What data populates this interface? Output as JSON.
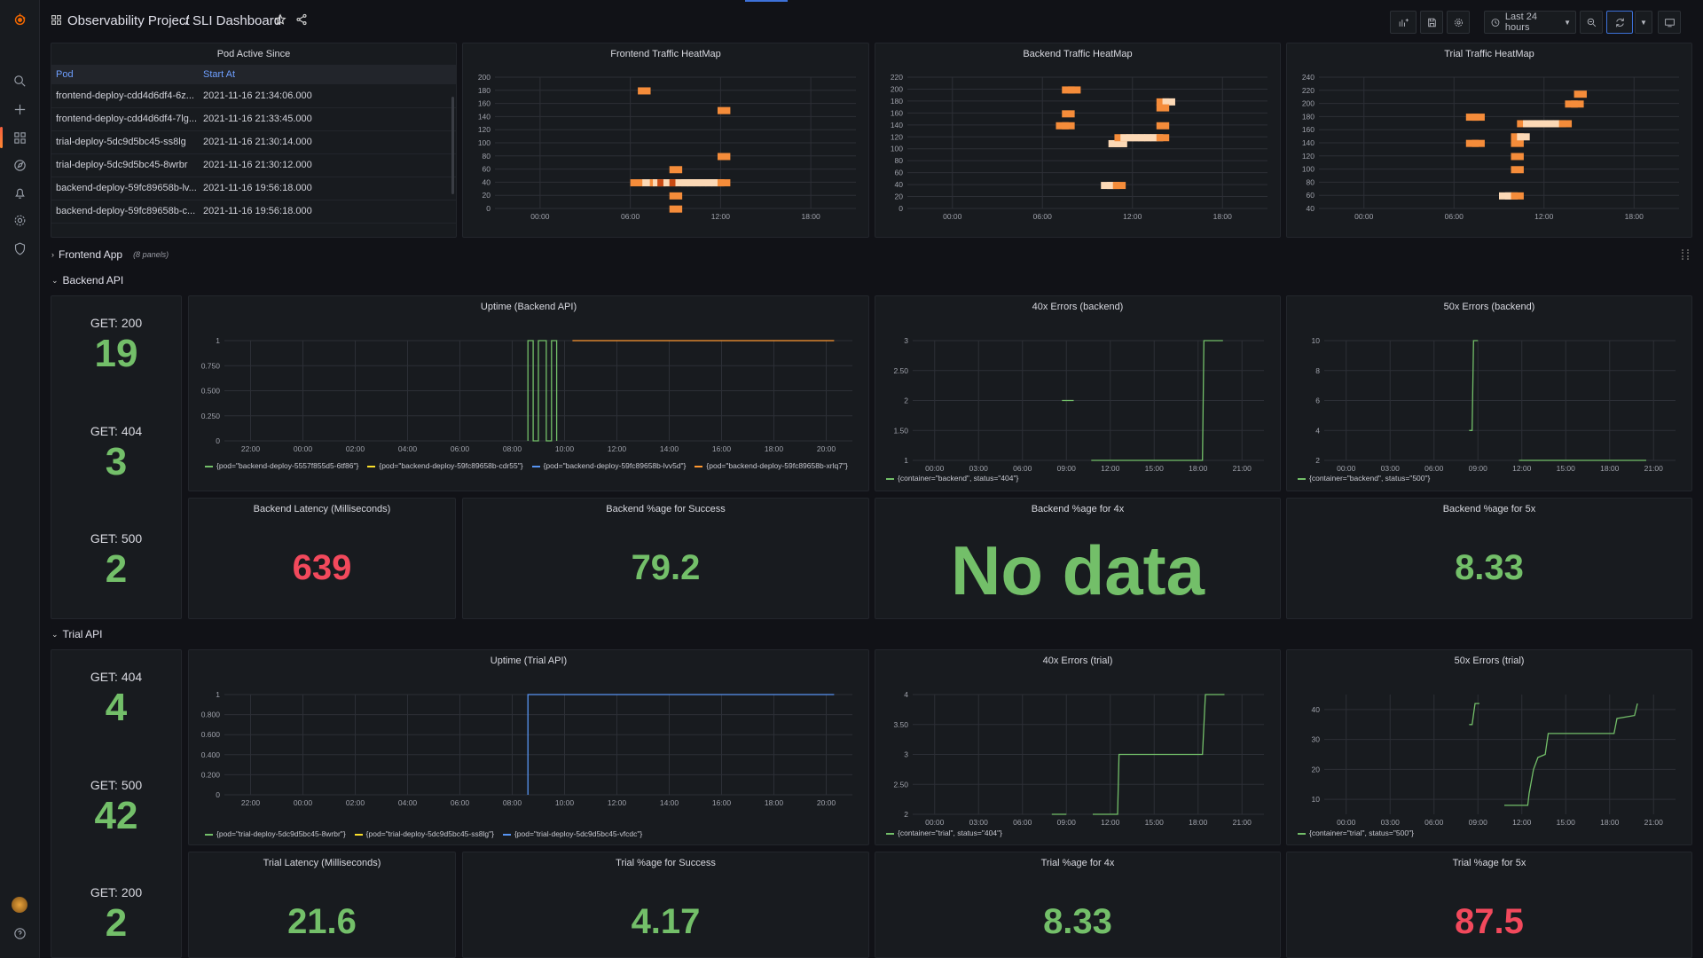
{
  "app": {
    "breadcrumb_folder": "Observability Project",
    "breadcrumb_sep": "/",
    "breadcrumb_dashboard": "SLI Dashboard",
    "time_range": "Last 24 hours"
  },
  "colors": {
    "green": "#73bf69",
    "red": "#f2495c",
    "blue": "#5794f2",
    "orange": "#ff9830",
    "yellow": "#fade2a",
    "accent": "#6e9fff"
  },
  "rail_icons": [
    "grafana-logo-icon",
    "search-icon",
    "plus-icon",
    "dashboards-icon",
    "explore-icon",
    "alerting-icon",
    "gear-icon",
    "shield-icon",
    "avatar",
    "help-icon"
  ],
  "pods_table": {
    "title": "Pod Active Since",
    "columns": [
      "Pod",
      "Start At"
    ],
    "rows": [
      [
        "frontend-deploy-cdd4d6df4-6z...",
        "2021-11-16 21:34:06.000"
      ],
      [
        "frontend-deploy-cdd4d6df4-7lg...",
        "2021-11-16 21:33:45.000"
      ],
      [
        "trial-deploy-5dc9d5bc45-ss8lg",
        "2021-11-16 21:30:14.000"
      ],
      [
        "trial-deploy-5dc9d5bc45-8wrbr",
        "2021-11-16 21:30:12.000"
      ],
      [
        "backend-deploy-59fc89658b-lv...",
        "2021-11-16 19:56:18.000"
      ],
      [
        "backend-deploy-59fc89658b-c...",
        "2021-11-16 19:56:18.000"
      ]
    ]
  },
  "rows": {
    "frontend": {
      "label": "Frontend App",
      "sub": "(8 panels)"
    },
    "backend": {
      "label": "Backend API"
    },
    "trial": {
      "label": "Trial API"
    }
  },
  "backend_codes": [
    {
      "label": "GET: 200",
      "value": "19"
    },
    {
      "label": "GET: 404",
      "value": "3"
    },
    {
      "label": "GET: 500",
      "value": "2"
    }
  ],
  "trial_codes": [
    {
      "label": "GET: 404",
      "value": "4"
    },
    {
      "label": "GET: 500",
      "value": "42"
    },
    {
      "label": "GET: 200",
      "value": "2"
    }
  ],
  "backend_stats": [
    {
      "title": "Backend Latency (Milliseconds)",
      "value": "639",
      "color": "#f2495c"
    },
    {
      "title": "Backend %age for Success",
      "value": "79.2",
      "color": "#73bf69"
    },
    {
      "title": "Backend %age for 4x",
      "value": "No data",
      "color": "#73bf69"
    },
    {
      "title": "Backend %age for 5x",
      "value": "8.33",
      "color": "#73bf69"
    }
  ],
  "trial_stats": [
    {
      "title": "Trial Latency (Milliseconds)",
      "value": "21.6",
      "color": "#73bf69"
    },
    {
      "title": "Trial %age for Success",
      "value": "4.17",
      "color": "#73bf69"
    },
    {
      "title": "Trial %age for 4x",
      "value": "8.33",
      "color": "#73bf69"
    },
    {
      "title": "Trial %age for 5x",
      "value": "87.5",
      "color": "#f2495c"
    }
  ],
  "chart_data": [
    {
      "id": "frontend_heatmap",
      "type": "heatmap",
      "title": "Frontend Traffic HeatMap",
      "x_ticks": [
        "00:00",
        "06:00",
        "12:00",
        "18:00"
      ],
      "y_ticks": [
        "0",
        "20",
        "40",
        "60",
        "80",
        "100",
        "120",
        "140",
        "160",
        "180",
        "200"
      ],
      "ylim": [
        0,
        200
      ],
      "cells": [
        [
          9.5,
          180,
          1
        ],
        [
          9.0,
          40,
          1
        ],
        [
          9.8,
          40,
          0
        ],
        [
          10.3,
          40,
          1
        ],
        [
          10.5,
          40,
          0
        ],
        [
          10.8,
          40,
          2
        ],
        [
          11.2,
          40,
          0
        ],
        [
          11.6,
          40,
          2
        ],
        [
          11.6,
          60,
          1
        ],
        [
          11.6,
          20,
          1
        ],
        [
          11.6,
          0,
          1
        ],
        [
          12.0,
          40,
          0
        ],
        [
          12.4,
          40,
          0
        ],
        [
          12.8,
          40,
          0
        ],
        [
          13.2,
          40,
          0
        ],
        [
          13.6,
          40,
          0
        ],
        [
          14.0,
          40,
          0
        ],
        [
          14.4,
          40,
          0
        ],
        [
          14.8,
          40,
          1
        ],
        [
          14.8,
          80,
          1
        ],
        [
          14.8,
          150,
          1
        ]
      ]
    },
    {
      "id": "backend_heatmap",
      "type": "heatmap",
      "title": "Backend Traffic HeatMap",
      "x_ticks": [
        "00:00",
        "06:00",
        "12:00",
        "18:00"
      ],
      "y_ticks": [
        "0",
        "20",
        "40",
        "60",
        "80",
        "100",
        "120",
        "140",
        "160",
        "180",
        "200",
        "220"
      ],
      "ylim": [
        0,
        220
      ],
      "cells": [
        [
          10.3,
          200,
          1
        ],
        [
          10.7,
          200,
          1
        ],
        [
          9.9,
          140,
          1
        ],
        [
          10.3,
          140,
          1
        ],
        [
          10.3,
          160,
          1
        ],
        [
          12.9,
          40,
          0
        ],
        [
          13.3,
          40,
          0
        ],
        [
          13.7,
          40,
          1
        ],
        [
          13.4,
          110,
          0
        ],
        [
          13.8,
          110,
          0
        ],
        [
          13.8,
          120,
          1
        ],
        [
          14.2,
          120,
          0
        ],
        [
          14.6,
          120,
          0
        ],
        [
          15.0,
          120,
          0
        ],
        [
          15.4,
          120,
          0
        ],
        [
          15.8,
          120,
          0
        ],
        [
          16.2,
          120,
          0
        ],
        [
          16.6,
          120,
          1
        ],
        [
          16.6,
          140,
          1
        ],
        [
          16.6,
          180,
          1
        ],
        [
          17.0,
          180,
          0
        ],
        [
          16.6,
          170,
          1
        ]
      ]
    },
    {
      "id": "trial_heatmap",
      "type": "heatmap",
      "title": "Trial Traffic HeatMap",
      "x_ticks": [
        "00:00",
        "06:00",
        "12:00",
        "18:00"
      ],
      "y_ticks": [
        "40",
        "60",
        "80",
        "100",
        "120",
        "140",
        "160",
        "180",
        "200",
        "220",
        "240"
      ],
      "ylim": [
        40,
        240
      ],
      "cells": [
        [
          9.8,
          180,
          1
        ],
        [
          10.2,
          180,
          1
        ],
        [
          9.8,
          140,
          1
        ],
        [
          10.2,
          140,
          1
        ],
        [
          12.0,
          60,
          0
        ],
        [
          12.4,
          60,
          0
        ],
        [
          12.8,
          60,
          1
        ],
        [
          12.8,
          100,
          1
        ],
        [
          12.8,
          120,
          1
        ],
        [
          12.8,
          140,
          1
        ],
        [
          12.8,
          150,
          1
        ],
        [
          13.2,
          150,
          0
        ],
        [
          13.2,
          170,
          1
        ],
        [
          13.6,
          170,
          0
        ],
        [
          14.0,
          170,
          0
        ],
        [
          14.4,
          170,
          0
        ],
        [
          14.8,
          170,
          0
        ],
        [
          15.2,
          170,
          0
        ],
        [
          15.6,
          170,
          0
        ],
        [
          16.0,
          170,
          1
        ],
        [
          16.4,
          200,
          1
        ],
        [
          16.8,
          200,
          1
        ],
        [
          17.0,
          215,
          1
        ]
      ]
    },
    {
      "id": "uptime_backend",
      "type": "line",
      "title": "Uptime (Backend API)",
      "x_ticks": [
        "22:00",
        "00:00",
        "02:00",
        "04:00",
        "06:00",
        "08:00",
        "10:00",
        "12:00",
        "14:00",
        "16:00",
        "18:00",
        "20:00"
      ],
      "y_ticks": [
        "0",
        "0.250",
        "0.500",
        "0.750",
        "1"
      ],
      "ylim": [
        0,
        1
      ],
      "series": [
        {
          "name": "{pod=\"backend-deploy-5557f855d5-6tf86\"}",
          "color": "#73bf69",
          "points": [
            [
              11.6,
              0
            ],
            [
              11.6,
              1
            ],
            [
              11.8,
              1
            ],
            [
              11.8,
              0
            ],
            [
              12.0,
              0
            ],
            [
              12.0,
              1
            ],
            [
              12.3,
              1
            ],
            [
              12.3,
              0
            ],
            [
              12.5,
              0
            ],
            [
              12.5,
              1
            ],
            [
              12.7,
              1
            ],
            [
              12.7,
              0
            ]
          ]
        },
        {
          "name": "{pod=\"backend-deploy-59fc89658b-cdr55\"}",
          "color": "#fade2a",
          "points": []
        },
        {
          "name": "{pod=\"backend-deploy-59fc89658b-lvv5d\"}",
          "color": "#5794f2",
          "points": []
        },
        {
          "name": "{pod=\"backend-deploy-59fc89658b-xrlq7\"}",
          "color": "#ff9830",
          "points": [
            [
              13.3,
              1
            ],
            [
              23.3,
              1
            ]
          ]
        }
      ]
    },
    {
      "id": "err40_backend",
      "type": "line",
      "title": "40x Errors (backend)",
      "x_ticks": [
        "00:00",
        "03:00",
        "06:00",
        "09:00",
        "12:00",
        "15:00",
        "18:00",
        "21:00"
      ],
      "y_ticks": [
        "1",
        "1.50",
        "2",
        "2.50",
        "3"
      ],
      "ylim": [
        1,
        3
      ],
      "series": [
        {
          "name": "{container=\"backend\", status=\"404\"}",
          "color": "#73bf69",
          "points": [
            [
              10.2,
              2
            ],
            [
              11.0,
              2
            ],
            [
              null,
              null
            ],
            [
              12.2,
              1
            ],
            [
              19.8,
              1
            ],
            [
              19.9,
              3
            ],
            [
              21.2,
              3
            ]
          ]
        }
      ]
    },
    {
      "id": "err50_backend",
      "type": "line",
      "title": "50x Errors (backend)",
      "x_ticks": [
        "00:00",
        "03:00",
        "06:00",
        "09:00",
        "12:00",
        "15:00",
        "18:00",
        "21:00"
      ],
      "y_ticks": [
        "2",
        "4",
        "6",
        "8",
        "10"
      ],
      "ylim": [
        2,
        10
      ],
      "series": [
        {
          "name": "{container=\"backend\", status=\"500\"}",
          "color": "#73bf69",
          "points": [
            [
              9.9,
              4
            ],
            [
              10.1,
              4
            ],
            [
              10.2,
              10
            ],
            [
              10.5,
              10
            ],
            [
              null,
              null
            ],
            [
              13.3,
              2
            ],
            [
              22.0,
              2
            ]
          ]
        }
      ]
    },
    {
      "id": "uptime_trial",
      "type": "line",
      "title": "Uptime (Trial API)",
      "x_ticks": [
        "22:00",
        "00:00",
        "02:00",
        "04:00",
        "06:00",
        "08:00",
        "10:00",
        "12:00",
        "14:00",
        "16:00",
        "18:00",
        "20:00"
      ],
      "y_ticks": [
        "0",
        "0.200",
        "0.400",
        "0.600",
        "0.800",
        "1"
      ],
      "ylim": [
        0,
        1
      ],
      "series": [
        {
          "name": "{pod=\"trial-deploy-5dc9d5bc45-8wrbr\"}",
          "color": "#73bf69",
          "points": []
        },
        {
          "name": "{pod=\"trial-deploy-5dc9d5bc45-ss8lg\"}",
          "color": "#fade2a",
          "points": []
        },
        {
          "name": "{pod=\"trial-deploy-5dc9d5bc45-vfcdc\"}",
          "color": "#5794f2",
          "points": [
            [
              11.6,
              0
            ],
            [
              11.6,
              1
            ],
            [
              23.3,
              1
            ]
          ]
        }
      ]
    },
    {
      "id": "err40_trial",
      "type": "line",
      "title": "40x Errors (trial)",
      "x_ticks": [
        "00:00",
        "03:00",
        "06:00",
        "09:00",
        "12:00",
        "15:00",
        "18:00",
        "21:00"
      ],
      "y_ticks": [
        "2",
        "2.50",
        "3",
        "3.50",
        "4"
      ],
      "ylim": [
        2,
        4
      ],
      "series": [
        {
          "name": "{container=\"trial\", status=\"404\"}",
          "color": "#73bf69",
          "points": [
            [
              9.5,
              2
            ],
            [
              10.5,
              2
            ],
            [
              null,
              null
            ],
            [
              12.3,
              2
            ],
            [
              14.0,
              2
            ],
            [
              14.1,
              3
            ],
            [
              19.8,
              3
            ],
            [
              20.0,
              4
            ],
            [
              21.3,
              4
            ]
          ]
        }
      ]
    },
    {
      "id": "err50_trial",
      "type": "line",
      "title": "50x Errors (trial)",
      "x_ticks": [
        "00:00",
        "03:00",
        "06:00",
        "09:00",
        "12:00",
        "15:00",
        "18:00",
        "21:00"
      ],
      "y_ticks": [
        "10",
        "20",
        "30",
        "40"
      ],
      "ylim": [
        5,
        45
      ],
      "series": [
        {
          "name": "{container=\"trial\", status=\"500\"}",
          "color": "#73bf69",
          "points": [
            [
              9.9,
              35
            ],
            [
              10.1,
              35
            ],
            [
              10.3,
              42
            ],
            [
              10.6,
              42
            ],
            [
              null,
              null
            ],
            [
              12.3,
              8
            ],
            [
              13.9,
              8
            ],
            [
              14.0,
              12
            ],
            [
              14.3,
              20
            ],
            [
              14.6,
              24
            ],
            [
              15.1,
              25
            ],
            [
              15.3,
              32
            ],
            [
              19.8,
              32
            ],
            [
              20.0,
              37
            ],
            [
              21.2,
              38
            ],
            [
              21.4,
              42
            ]
          ]
        }
      ]
    }
  ]
}
